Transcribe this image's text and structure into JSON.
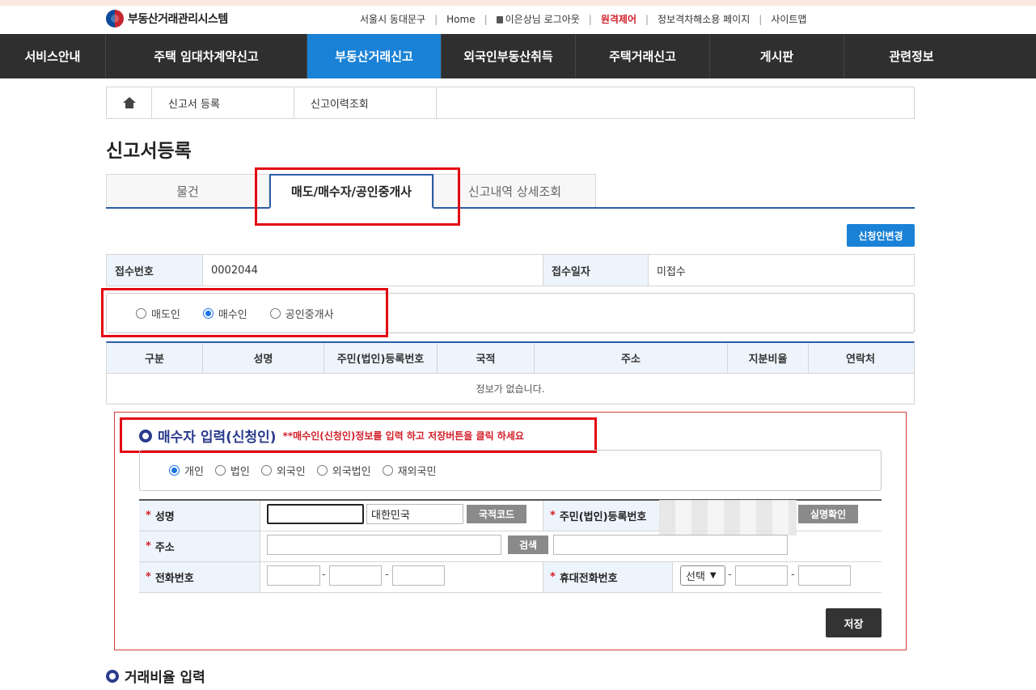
{
  "header": {
    "logo_text": "부동산거래관리시스템",
    "links": [
      "서울시 동대문구",
      "Home",
      "이은상님 로그아웃",
      "원격제어",
      "정보격차해소용 페이지",
      "사이트맵"
    ]
  },
  "nav": [
    "서비스안내",
    "주택 임대차계약신고",
    "부동산거래신고",
    "외국인부동산취득",
    "주택거래신고",
    "게시판",
    "관련정보"
  ],
  "breadcrumb": [
    "신고서 등록",
    "신고이력조회"
  ],
  "page_title": "신고서등록",
  "tabs": [
    "물건",
    "매도/매수자/공인중개사",
    "신고내역 상세조회"
  ],
  "applicant_change_button": "신청인변경",
  "receipt": {
    "number_label": "접수번호",
    "number_value": "0002044",
    "date_label": "접수일자",
    "date_value": "미접수"
  },
  "party_radios": [
    {
      "label": "매도인",
      "checked": false
    },
    {
      "label": "매수인",
      "checked": true
    },
    {
      "label": "공인중개사",
      "checked": false
    }
  ],
  "party_table": {
    "headers": [
      "구분",
      "성명",
      "주민(법인)등록번호",
      "국적",
      "주소",
      "지분비율",
      "연락처"
    ],
    "empty_text": "정보가 없습니다."
  },
  "buyer_section": {
    "title": "매수자 입력(신청인)",
    "note": "**매수인(신청인)정보를 입력 하고 저장버튼을 클릭 하세요",
    "type_radios": [
      {
        "label": "개인",
        "checked": true
      },
      {
        "label": "법인",
        "checked": false
      },
      {
        "label": "외국인",
        "checked": false
      },
      {
        "label": "외국법인",
        "checked": false
      },
      {
        "label": "재외국민",
        "checked": false
      }
    ],
    "fields": {
      "name_label": "성명",
      "nationality_value": "대한민국",
      "nationality_code_button": "국적코드",
      "rrn_label": "주민(법인)등록번호",
      "verify_button": "실명확인",
      "address_label": "주소",
      "search_button": "검색",
      "phone_label": "전화번호",
      "mobile_label": "휴대전화번호",
      "mobile_select": "선택",
      "dash": "-"
    },
    "save_button": "저장"
  },
  "trade_ratio_title": "거래비율 입력",
  "colors": {
    "nav_bg": "#2f2f2f",
    "nav_active": "#1a82d6",
    "tab_border": "#2b5ca8",
    "highlight": "#e30613",
    "section_title": "#2b3b8c"
  }
}
